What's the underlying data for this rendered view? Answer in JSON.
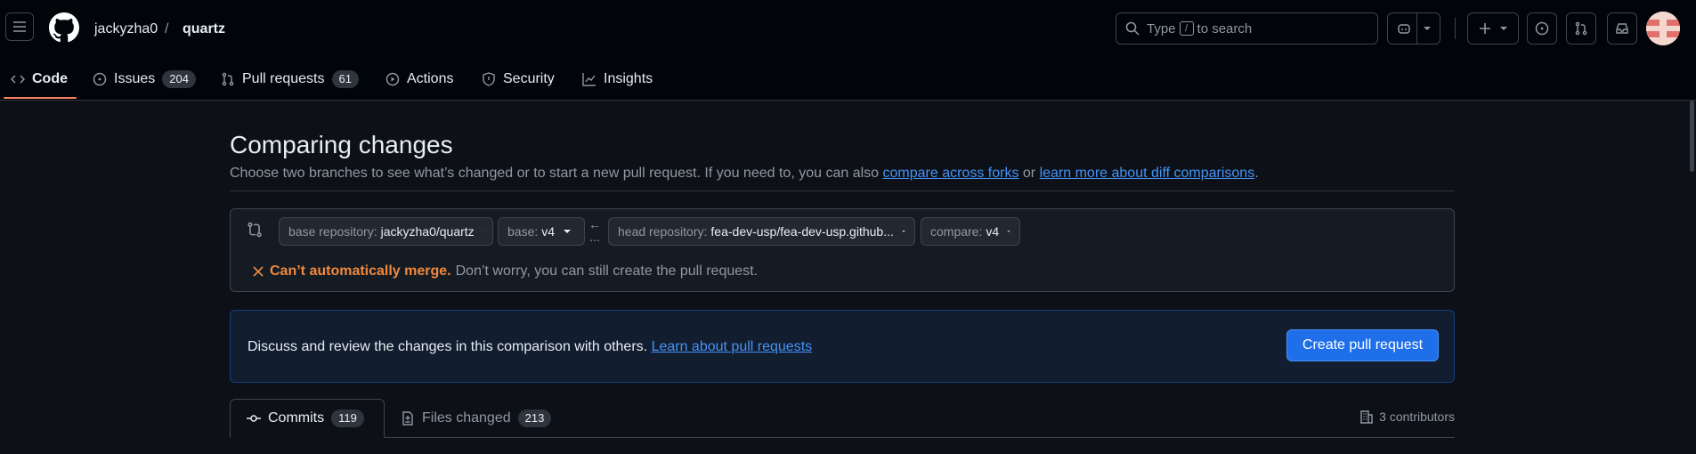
{
  "header": {
    "owner": "jackyzha0",
    "separator": "/",
    "repo": "quartz",
    "search_prefix": "Type",
    "search_key": "/",
    "search_suffix": "to search"
  },
  "repo_tabs": [
    {
      "label": "Code",
      "icon": "code-icon"
    },
    {
      "label": "Issues",
      "count": "204",
      "icon": "issue-opened-icon"
    },
    {
      "label": "Pull requests",
      "count": "61",
      "icon": "git-pull-request-icon"
    },
    {
      "label": "Actions",
      "icon": "play-icon"
    },
    {
      "label": "Security",
      "icon": "shield-icon"
    },
    {
      "label": "Insights",
      "icon": "graph-icon"
    }
  ],
  "page": {
    "title": "Comparing changes",
    "description_prefix": "Choose two branches to see what’s changed or to start a new pull request. If you need to, you can also",
    "link_forks": "compare across forks",
    "or": "or",
    "link_diff": "learn more about diff comparisons",
    "period": "."
  },
  "range": {
    "base_repo_label": "base repository:",
    "base_repo_value": "jackyzha0/quartz",
    "base_label": "base:",
    "base_value": "v4",
    "arrow": "←",
    "dots": "...",
    "head_repo_label": "head repository:",
    "head_repo_value": "fea-dev-usp/fea-dev-usp.github...",
    "compare_label": "compare:",
    "compare_value": "v4",
    "merge_status": "Can’t automatically merge.",
    "merge_note": "Don’t worry, you can still create the pull request."
  },
  "discuss": {
    "text": "Discuss and review the changes in this comparison with others.",
    "link": "Learn about pull requests",
    "button": "Create pull request"
  },
  "compare_tabs": {
    "commits_label": "Commits",
    "commits_count": "119",
    "files_label": "Files changed",
    "files_count": "213",
    "contributors": "3 contributors"
  },
  "colors": {
    "background": "#0d1117",
    "header": "#010409",
    "accent": "#1f6feb",
    "link": "#4493f8",
    "warning": "#f0883e",
    "tab_underline": "#f78166"
  }
}
